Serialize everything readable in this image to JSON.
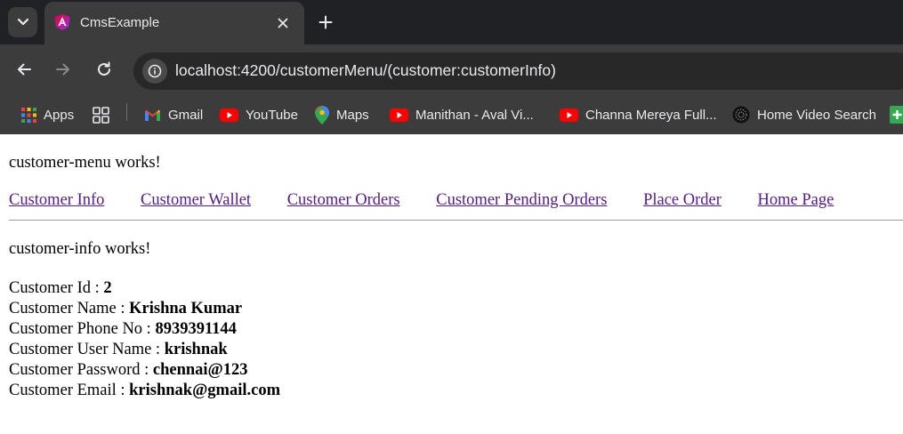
{
  "browser": {
    "tab": {
      "title": "CmsExample"
    },
    "address_bar": {
      "url": "localhost:4200/customerMenu/(customer:customerInfo)"
    },
    "bookmarks": [
      {
        "label": "Apps",
        "icon": "apps-grid-icon"
      },
      {
        "label": "",
        "icon": "tab-groups-icon"
      },
      {
        "label": "Gmail",
        "icon": "gmail-icon"
      },
      {
        "label": "YouTube",
        "icon": "youtube-icon"
      },
      {
        "label": "Maps",
        "icon": "maps-pin-icon"
      },
      {
        "label": "Manithan - Aval Vi...",
        "icon": "youtube-icon"
      },
      {
        "label": "Channa Mereya Full...",
        "icon": "youtube-icon"
      },
      {
        "label": "Home Video Search",
        "icon": "globe-icon"
      }
    ]
  },
  "page": {
    "menu_works": "customer-menu works!",
    "nav": [
      "Customer Info",
      "Customer Wallet",
      "Customer Orders",
      "Customer Pending Orders",
      "Place Order",
      "Home Page"
    ],
    "info_works": "customer-info works!",
    "details": [
      {
        "label": "Customer Id : ",
        "value": "2"
      },
      {
        "label": "Customer Name : ",
        "value": "Krishna Kumar"
      },
      {
        "label": "Customer Phone No : ",
        "value": "8939391144"
      },
      {
        "label": "Customer User Name : ",
        "value": "krishnak"
      },
      {
        "label": "Customer Password : ",
        "value": "chennai@123"
      },
      {
        "label": "Customer Email : ",
        "value": "krishnak@gmail.com"
      }
    ]
  },
  "colors": {
    "tabstrip": "#202124",
    "toolbar": "#3c3c3c",
    "link_visited": "#551a8b",
    "youtube_red": "#ff0000"
  }
}
